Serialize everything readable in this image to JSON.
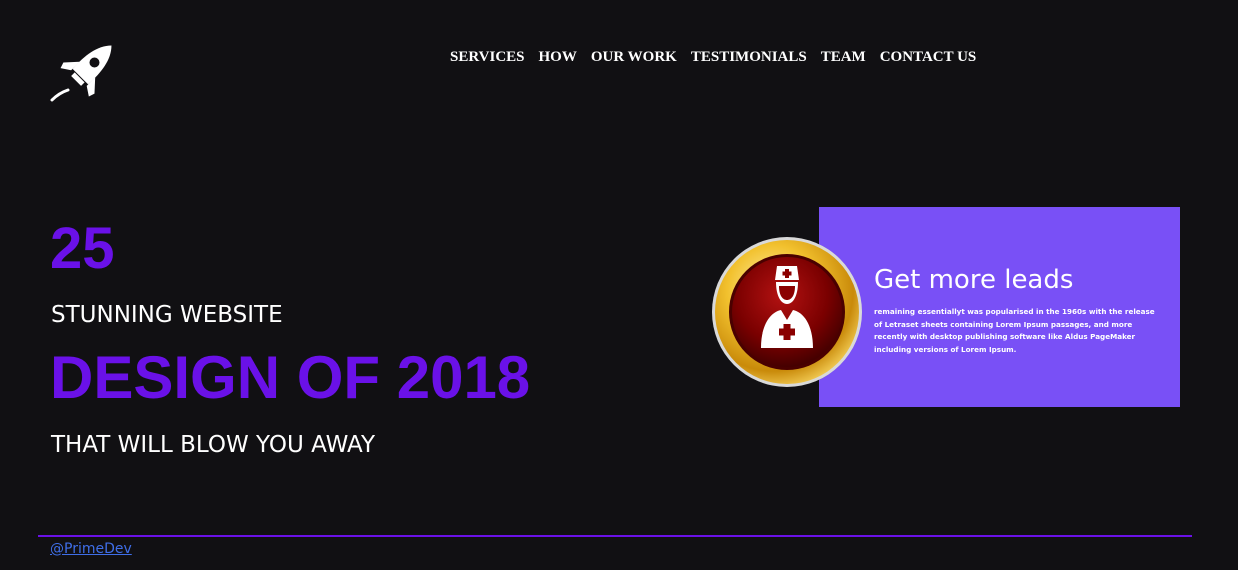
{
  "nav": {
    "items": [
      "SERVICES",
      "HOW",
      "OUR WORK",
      "TESTIMONIALS",
      "TEAM",
      "CONTACT US"
    ]
  },
  "hero": {
    "number": "25",
    "subtitle": "STUNNING WEBSITE",
    "headline": "DESIGN OF 2018",
    "tagline": "THAT WILL BLOW YOU AWAY"
  },
  "card": {
    "title": "Get more leads",
    "body": "remaining essentiallyt was popularised in the 1960s with the release of Letraset sheets containing Lorem Ipsum passages, and more recently with desktop publishing software like Aldus PageMaker including versions of Lorem Ipsum."
  },
  "footer": {
    "link": "@PrimeDev"
  },
  "icons": {
    "logo": "rocket-icon",
    "badge": "nurse-icon"
  },
  "colors": {
    "background": "#111013",
    "accent_purple": "#6a11e8",
    "card_purple": "#7950f6",
    "link_blue": "#3f6ee8",
    "badge_red": "#8b0000",
    "badge_gold": "#f2c12e"
  }
}
